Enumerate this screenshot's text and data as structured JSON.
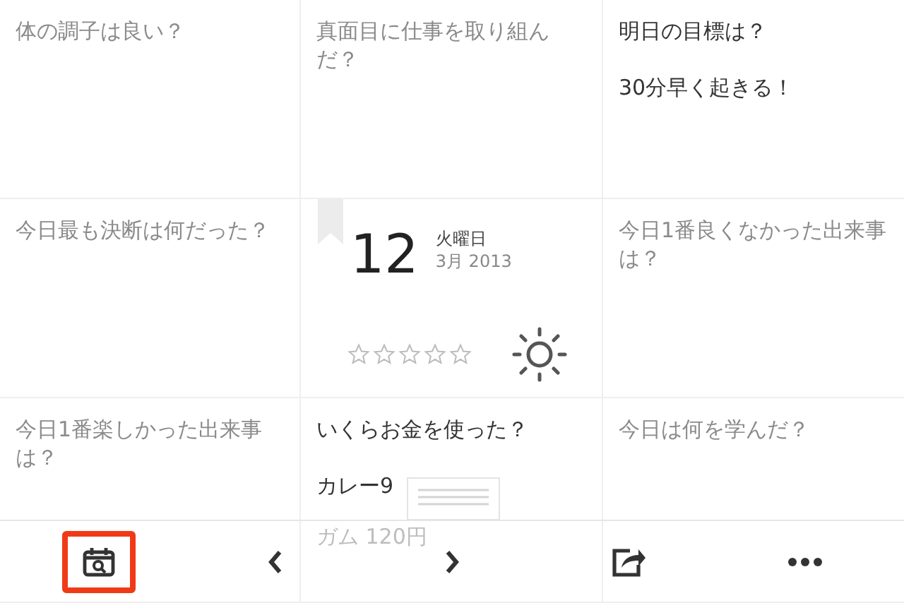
{
  "cells": [
    {
      "kind": "question",
      "question": "体の調子は良い？",
      "answered": false
    },
    {
      "kind": "question",
      "question": "真面目に仕事を取り組んだ？",
      "answered": false
    },
    {
      "kind": "question",
      "question": "明日の目標は？",
      "answered": true,
      "answer_lines": [
        "30分早く起きる！"
      ]
    },
    {
      "kind": "question",
      "question": "今日最も決断は何だった？",
      "answered": false
    },
    {
      "kind": "date",
      "day": "12",
      "weekday": "火曜日",
      "month_year": "3月 2013",
      "stars": 0,
      "bookmarked": true
    },
    {
      "kind": "question",
      "question": "今日1番良くなかった出来事は？",
      "answered": false
    },
    {
      "kind": "question",
      "question": "今日1番楽しかった出来事は？",
      "answered": false
    },
    {
      "kind": "question",
      "question": "いくらお金を使った？",
      "answered": true,
      "answer_lines": [
        "カレー9",
        "ガム 120円"
      ]
    },
    {
      "kind": "question",
      "question": "今日は何を学んだ？",
      "answered": false
    }
  ],
  "toolbar": [
    {
      "kind": "calendar-search",
      "selected": true
    },
    {
      "kind": "prev",
      "selected": false
    },
    {
      "kind": "next",
      "selected": false
    },
    {
      "kind": "share",
      "selected": false
    },
    {
      "kind": "more",
      "selected": false
    }
  ]
}
